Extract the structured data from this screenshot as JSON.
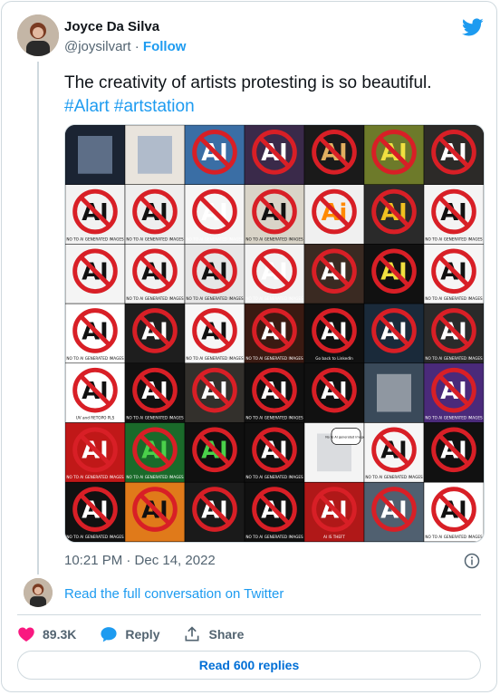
{
  "author": {
    "display_name": "Joyce Da Silva",
    "handle": "@joysilvart",
    "separator": " · ",
    "follow_label": "Follow"
  },
  "tweet": {
    "text": "The creativity of artists protesting is so beautiful.",
    "hashtags": [
      "#Alart",
      "#artstation"
    ],
    "timestamp": "10:21 PM · Dec 14, 2022"
  },
  "media": {
    "icon": "ai-protest-collage",
    "captions": {
      "no_ai_generated": "NO TO AI GENERATED IMAGES",
      "uv_retopo": "UV and RETOPO PLS",
      "go_back_linkedin": "Go back to LinkedIn",
      "ai_is_theft": "AI IS THEFT",
      "ai_label": "AI",
      "ai_small": "Ai",
      "no_ai_bubble": "No to AI generated images"
    },
    "colors": {
      "ban_red": "#d81f26",
      "black": "#111111",
      "white": "#ffffff"
    }
  },
  "footer": {
    "read_conversation": "Read the full conversation on Twitter",
    "like_count": "89.3K",
    "reply_label": "Reply",
    "share_label": "Share",
    "read_replies": "Read 600 replies"
  },
  "colors": {
    "accent": "#1d9bf0",
    "like": "#f91880",
    "muted": "#536471",
    "border": "#cfd9de"
  },
  "icons": [
    "twitter-bird-icon",
    "info-icon",
    "heart-icon",
    "reply-bubble-icon",
    "share-icon"
  ]
}
